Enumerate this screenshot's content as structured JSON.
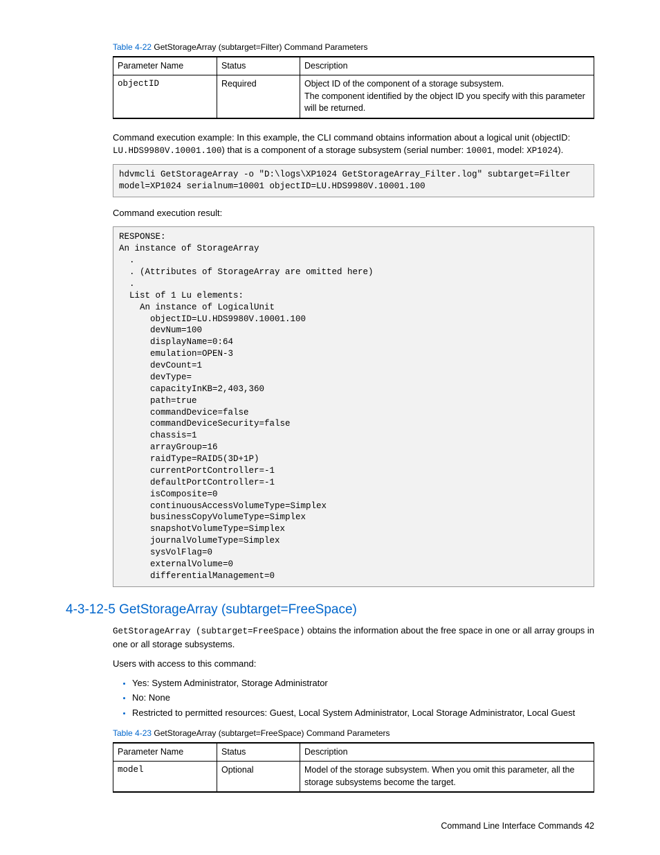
{
  "table22": {
    "caption_num": "Table 4-22",
    "caption_text": "  GetStorageArray (subtarget=Filter) Command Parameters",
    "headers": [
      "Parameter Name",
      "Status",
      "Description"
    ],
    "row": {
      "param": "objectID",
      "status": "Required",
      "desc": "Object ID of the component of a storage subsystem.\nThe component identified by the object ID you specify with this parameter will be returned."
    }
  },
  "exec_example": {
    "prefix": "Command execution example: In this example, the CLI command obtains information about a logical unit (objectID: ",
    "oid": "LU.HDS9980V.10001.100",
    "mid": ") that is a component of a storage subsystem (serial number: ",
    "serial": "10001",
    "mid2": ", model: ",
    "model": "XP1024",
    "suffix": ")."
  },
  "code1": "hdvmcli GetStorageArray -o \"D:\\logs\\XP1024 GetStorageArray_Filter.log\" subtarget=Filter\nmodel=XP1024 serialnum=10001 objectID=LU.HDS9980V.10001.100",
  "result_label": "Command execution result:",
  "code2": "RESPONSE:\nAn instance of StorageArray\n  .\n  . (Attributes of StorageArray are omitted here)\n  .\n  List of 1 Lu elements:\n    An instance of LogicalUnit\n      objectID=LU.HDS9980V.10001.100\n      devNum=100\n      displayName=0:64\n      emulation=OPEN-3\n      devCount=1\n      devType=\n      capacityInKB=2,403,360\n      path=true\n      commandDevice=false\n      commandDeviceSecurity=false\n      chassis=1\n      arrayGroup=16\n      raidType=RAID5(3D+1P)\n      currentPortController=-1\n      defaultPortController=-1\n      isComposite=0\n      continuousAccessVolumeType=Simplex\n      businessCopyVolumeType=Simplex\n      snapshotVolumeType=Simplex\n      journalVolumeType=Simplex\n      sysVolFlag=0\n      externalVolume=0\n      differentialManagement=0",
  "section": {
    "title": "4-3-12-5 GetStorageArray (subtarget=FreeSpace)",
    "p1_code": "GetStorageArray (subtarget=FreeSpace)",
    "p1_rest": " obtains the information about the free space in one or all array groups in one or all storage subsystems.",
    "p2": "Users with access to this command:",
    "bullets": [
      "Yes: System Administrator, Storage Administrator",
      "No: None",
      "Restricted to permitted resources: Guest, Local System Administrator, Local Storage Administrator, Local Guest"
    ]
  },
  "table23": {
    "caption_num": "Table 4-23",
    "caption_text": "  GetStorageArray (subtarget=FreeSpace) Command Parameters",
    "headers": [
      "Parameter Name",
      "Status",
      "Description"
    ],
    "row": {
      "param": "model",
      "status": "Optional",
      "desc": "Model of the storage subsystem. When you omit this parameter, all the storage subsystems become the target."
    }
  },
  "footer": "Command Line Interface Commands   42"
}
